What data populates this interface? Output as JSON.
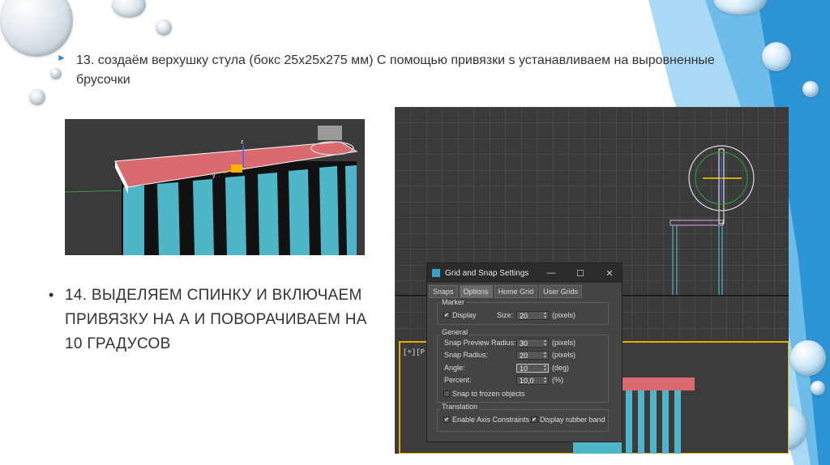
{
  "slide": {
    "step13_text": "13. создаём верхушку стула (бокс 25х25х275 мм) С помощью привязки s устанавливаем на выровненные брусочки",
    "step14_bullet": "•",
    "step14_text": "14. ВЫДЕЛЯЕМ СПИНКУ И ВКЛЮЧАЕМ ПРИВЯЗКУ НА А И ПОВОРАЧИВАЕМ НА 10 ГРАДУСОВ",
    "bullet13_glyph": "►"
  },
  "viewport1": {
    "axis_z": "z",
    "axis_y": "y"
  },
  "viewport2": {
    "label": "[+][P"
  },
  "dialog": {
    "title": "Grid and Snap Settings",
    "minimize": "—",
    "maximize": "☐",
    "close": "✕",
    "tabs": [
      "Snaps",
      "Options",
      "Home Grid",
      "User Grids"
    ],
    "active_tab": "Options",
    "marker": {
      "group_label": "Marker",
      "display_label": "Display",
      "display_checked": true,
      "size_label": "Size:",
      "size_value": "20",
      "size_unit": "(pixels)"
    },
    "general": {
      "group_label": "General",
      "snap_preview_radius_label": "Snap Preview Radius:",
      "snap_preview_radius_value": "30",
      "snap_preview_radius_unit": "(pixels)",
      "snap_radius_label": "Snap Radius:",
      "snap_radius_value": "20",
      "snap_radius_unit": "(pixels)",
      "angle_label": "Angle:",
      "angle_value": "10",
      "angle_unit": "(deg)",
      "percent_label": "Percent:",
      "percent_value": "10,0",
      "percent_unit": "(%)",
      "snap_frozen_label": "Snap to frozen objects",
      "snap_frozen_checked": false
    },
    "translation": {
      "group_label": "Translation",
      "enable_axis_label": "Enable Axis Constraints",
      "enable_axis_checked": true,
      "rubber_band_label": "Display rubber band",
      "rubber_band_checked": true
    }
  },
  "colors": {
    "accent": "#2e8fd0",
    "box_red": "#d96a6f",
    "slat_cyan": "#4fb6c8"
  }
}
